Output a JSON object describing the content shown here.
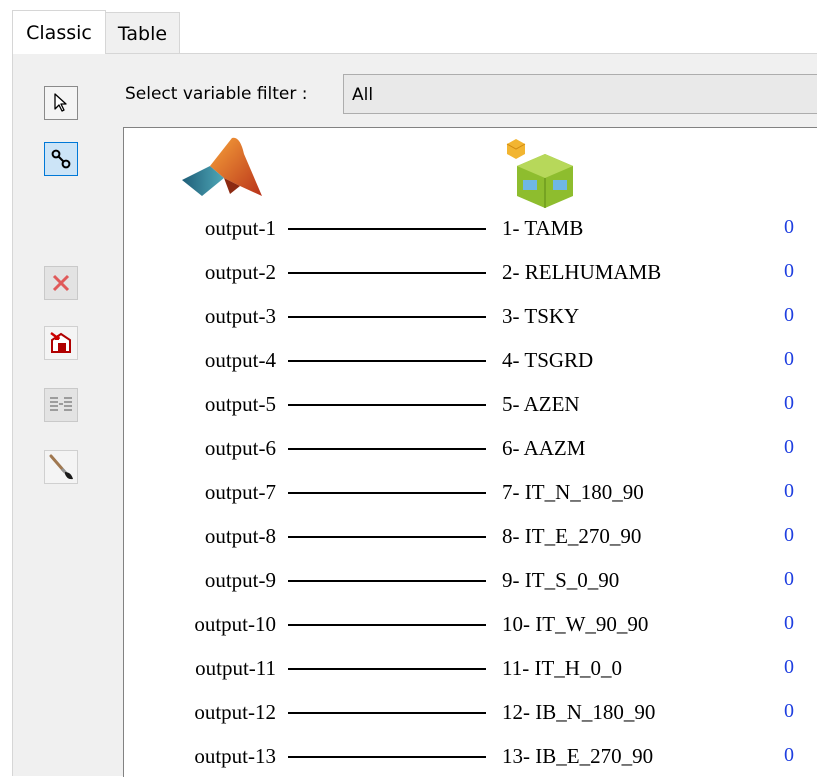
{
  "tabs": [
    {
      "label": "Classic",
      "active": true
    },
    {
      "label": "Table",
      "active": false
    }
  ],
  "toolbar": {
    "select_icon": "cursor-arrow-icon",
    "connect_icon": "link-icon",
    "delete_icon": "red-x-icon",
    "clear_icon": "delete-connections-icon",
    "auto_connect_icon": "auto-connect-icon",
    "paint_icon": "paintbrush-icon"
  },
  "filter": {
    "label": "Select variable filter :",
    "value": "All"
  },
  "logos": {
    "left": "matlab-logo-icon",
    "right": "trnsys-component-icon"
  },
  "colors": {
    "count": "#1f3fe0",
    "active_tool_border": "#0078d7"
  },
  "connections": [
    {
      "output": "output-1",
      "input": "1- TAMB",
      "count": "0"
    },
    {
      "output": "output-2",
      "input": "2- RELHUMAMB",
      "count": "0"
    },
    {
      "output": "output-3",
      "input": "3- TSKY",
      "count": "0"
    },
    {
      "output": "output-4",
      "input": "4- TSGRD",
      "count": "0"
    },
    {
      "output": "output-5",
      "input": "5- AZEN",
      "count": "0"
    },
    {
      "output": "output-6",
      "input": "6- AAZM",
      "count": "0"
    },
    {
      "output": "output-7",
      "input": "7- IT_N_180_90",
      "count": "0"
    },
    {
      "output": "output-8",
      "input": "8- IT_E_270_90",
      "count": "0"
    },
    {
      "output": "output-9",
      "input": "9- IT_S_0_90",
      "count": "0"
    },
    {
      "output": "output-10",
      "input": "10- IT_W_90_90",
      "count": "0"
    },
    {
      "output": "output-11",
      "input": "11- IT_H_0_0",
      "count": "0"
    },
    {
      "output": "output-12",
      "input": "12- IB_N_180_90",
      "count": "0"
    },
    {
      "output": "output-13",
      "input": "13- IB_E_270_90",
      "count": "0"
    }
  ]
}
